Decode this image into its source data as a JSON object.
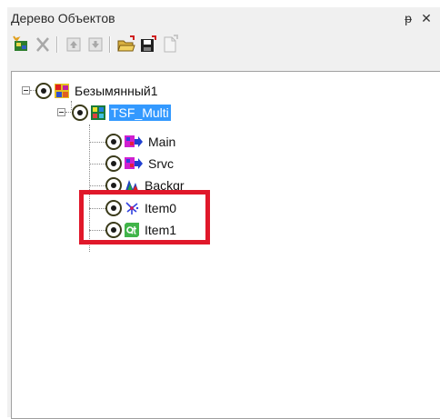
{
  "window": {
    "title": "Дерево Объектов",
    "pin_glyph": "ᵽ",
    "close_glyph": "✕"
  },
  "toolbar": {
    "buttons": [
      {
        "icon": "add-object-icon"
      },
      {
        "icon": "delete-icon"
      },
      {
        "icon": "move-up-icon"
      },
      {
        "icon": "move-down-icon"
      },
      {
        "icon": "open-folder-icon"
      },
      {
        "icon": "save-icon"
      },
      {
        "icon": "new-document-icon"
      }
    ]
  },
  "tree": {
    "nodes": [
      {
        "label": "Безымянный1",
        "icon": "project-icon",
        "selected": false
      },
      {
        "label": "TSF_Multi",
        "icon": "multi-scene-icon",
        "selected": true
      },
      {
        "label": "Main",
        "icon": "scene-arrow-icon",
        "selected": false
      },
      {
        "label": "Srvc",
        "icon": "scene-arrow-icon",
        "selected": false
      },
      {
        "label": "Backgr",
        "icon": "background-icon",
        "selected": false
      },
      {
        "label": "Item0",
        "icon": "starburst-icon",
        "selected": false
      },
      {
        "label": "Item1",
        "icon": "qt-icon",
        "selected": false
      }
    ]
  },
  "colors": {
    "selection": "#3399ff",
    "highlight_box": "#e0182a"
  }
}
